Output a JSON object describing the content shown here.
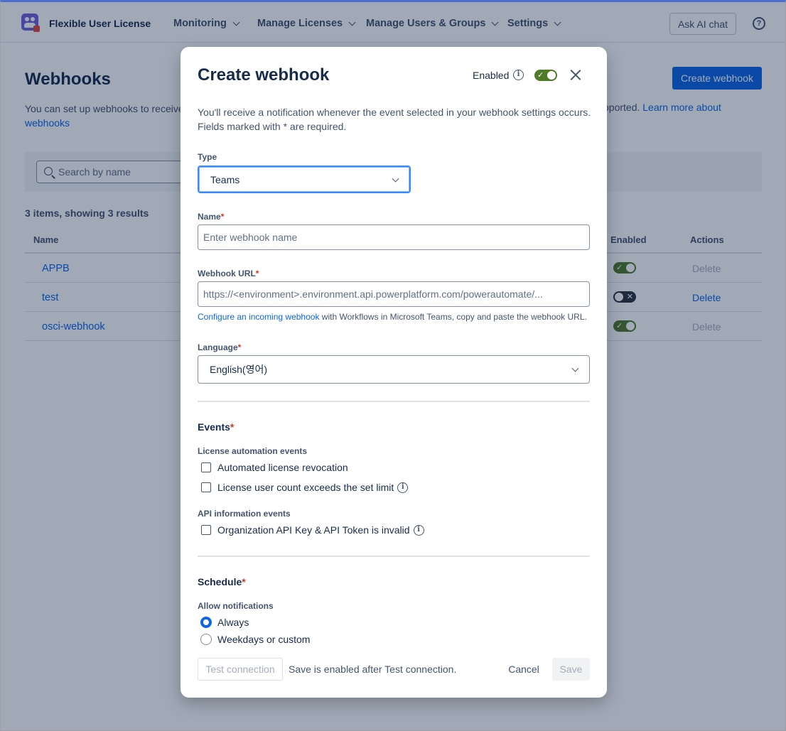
{
  "app": {
    "name": "Flexible User License"
  },
  "nav": {
    "items": [
      "Monitoring",
      "Manage Licenses",
      "Manage Users & Groups",
      "Settings"
    ],
    "ask_ai": "Ask AI chat",
    "help_glyph": "?"
  },
  "page": {
    "title": "Webhooks",
    "desc_left": "You can set up webhooks to receive",
    "desc_right": "pported.",
    "learn_more_1": "Learn more about",
    "learn_more_2": "webhooks",
    "create_button": "Create webhook",
    "search_placeholder": "Search by name",
    "count": "3 items, showing 3 results",
    "columns": {
      "name": "Name",
      "enabled": "Enabled",
      "actions": "Actions"
    },
    "rows": [
      {
        "name": "APPB",
        "enabled": true,
        "action": "Delete",
        "action_active": false
      },
      {
        "name": "test",
        "enabled": false,
        "action": "Delete",
        "action_active": true
      },
      {
        "name": "osci-webhook",
        "enabled": true,
        "action": "Delete",
        "action_active": false
      }
    ]
  },
  "modal": {
    "title": "Create webhook",
    "enabled_label": "Enabled",
    "enabled": true,
    "description_1": "You'll receive a notification whenever the event selected in your webhook settings occurs.",
    "description_2": "Fields marked with * are required.",
    "type_label": "Type",
    "type_value": "Teams",
    "name_label": "Name",
    "name_placeholder": "Enter webhook name",
    "url_label": "Webhook URL",
    "url_placeholder": "https://<environment>.environment.api.powerplatform.com/powerautomate/...",
    "helper_link": "Configure an incoming webhook",
    "helper_text": " with Workflows in Microsoft Teams, copy and paste the webhook URL.",
    "language_label": "Language",
    "language_value": "English(영어)",
    "events_title": "Events",
    "license_events_label": "License automation events",
    "license_events": [
      "Automated license revocation",
      "License user count exceeds the set limit"
    ],
    "api_events_label": "API information events",
    "api_events": [
      "Organization API Key & API Token is invalid"
    ],
    "schedule_title": "Schedule",
    "allow_label": "Allow notifications",
    "schedule_options": [
      "Always",
      "Weekdays or custom"
    ],
    "selected_schedule": 0,
    "test_button": "Test connection",
    "save_note": "Save is enabled after Test connection.",
    "cancel_button": "Cancel",
    "save_button": "Save",
    "required_mark": "*",
    "info_glyph": "i"
  },
  "colors": {
    "accent": "#0c66e4",
    "toggle_on": "#4f7a28",
    "toggle_off": "#2c333a",
    "required": "#c9372c"
  }
}
